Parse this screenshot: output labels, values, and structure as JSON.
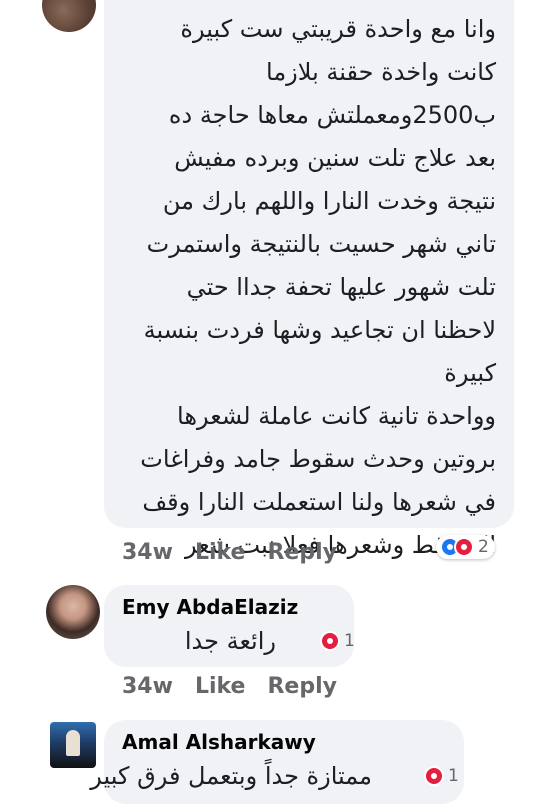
{
  "main_comment": {
    "lines": [
      "وانا مع واحدة قريبتي ست كبيرة",
      "كانت واخدة حقنة بلازما",
      "ب2500ومعملتش معاها حاجة ده",
      "بعد علاج تلت سنين وبرده مفيش",
      "نتيجة وخدت النارا واللهم بارك من",
      "تاني شهر حسيت بالنتيجة واستمرت",
      "تلت شهور عليها تحفة جداا حتي",
      "لاحظنا ان تجاعيد وشها فردت بنسبة",
      "كبيرة",
      "وواحدة تانية كانت عاملة لشعرها",
      "بروتين وحدث سقوط جامد وفراغات",
      "في شعرها ولنا استعملت النارا وقف",
      "التساقط وشعرها فعلا نبت شعر"
    ],
    "time": "34w",
    "like_label": "Like",
    "reply_label": "Reply",
    "reaction_count": "2"
  },
  "replies": [
    {
      "author": "Emy AbdaElaziz",
      "text": "رائعة جدا",
      "reaction_count": "1",
      "time": "34w",
      "like_label": "Like",
      "reply_label": "Reply"
    },
    {
      "author": "Amal Alsharkawy",
      "text": "ممتازة جداً وبتعمل فرق كبير",
      "reaction_count": "1"
    }
  ]
}
